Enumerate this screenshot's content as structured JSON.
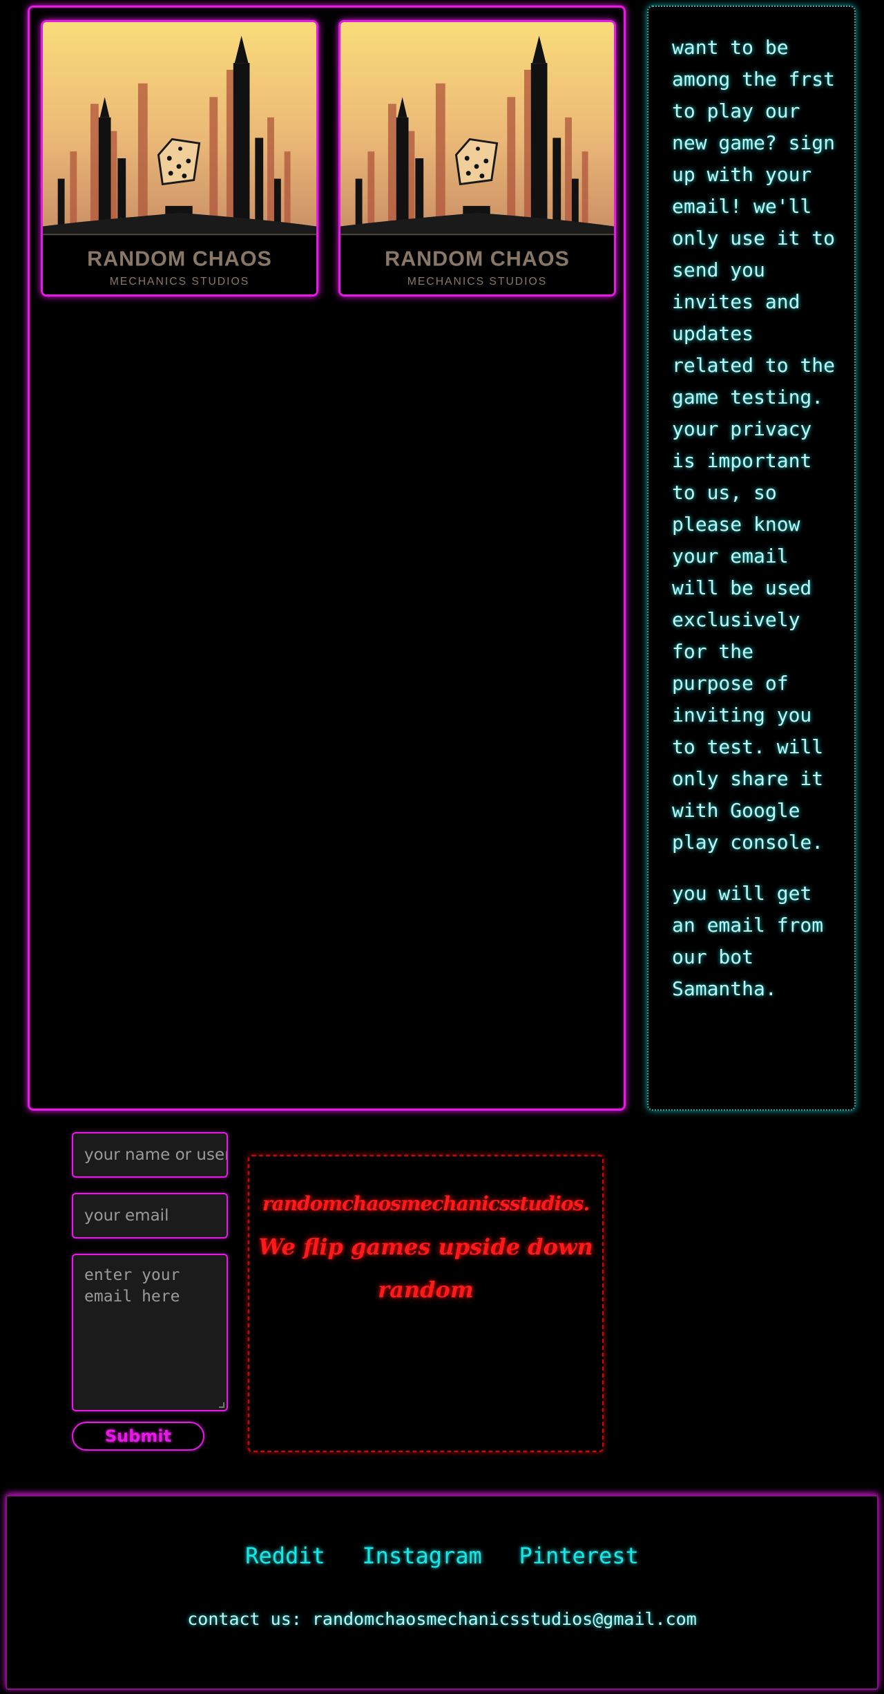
{
  "gallery": {
    "logo": {
      "title": "RANDOM CHAOS",
      "subtitle": "MECHANICS STUDIOS"
    }
  },
  "info": {
    "paragraph1": "want to be among the frst to play our new game? sign up with your email! we'll only use it to send you invites and updates related to the game testing. your privacy is important to us, so please know your email will be used exclusively for the purpose of inviting you to test. will only share it with Google play console.",
    "paragraph2": "you will get an email from our bot Samantha."
  },
  "form": {
    "name_placeholder": "your name or username",
    "email_placeholder": "your email",
    "message_placeholder": "enter your email here",
    "submit_label": "Submit"
  },
  "tagline": {
    "line1": "randomchaosmechanicsstudios.",
    "line2": "We flip games upside down",
    "line3": "random"
  },
  "footer": {
    "links": [
      "Reddit",
      "Instagram",
      "Pinterest"
    ],
    "contact": "contact us: randomchaosmechanicsstudios@gmail.com"
  },
  "colors": {
    "neon_magenta": "#e619e6",
    "neon_cyan": "#19e6e6",
    "neon_red": "#ff1a1a",
    "background": "#000000"
  }
}
